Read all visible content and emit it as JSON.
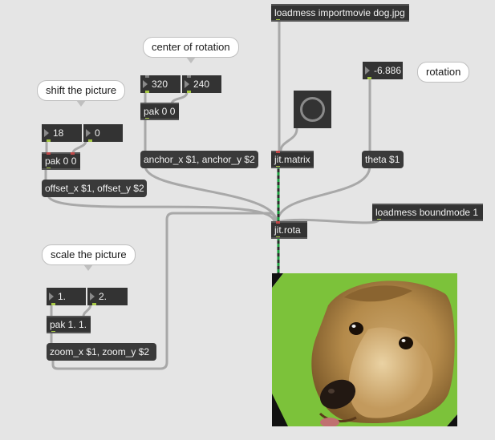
{
  "objects": {
    "loadmess_movie": "loadmess importmovie dog.jpg",
    "pak_anchor": "pak 0 0",
    "anchor_msg": "anchor_x $1, anchor_y $2",
    "num_320": "320",
    "num_240": "240",
    "num_theta": "-6.886",
    "theta_msg": "theta $1",
    "jit_matrix": "jit.matrix",
    "num_18": "18",
    "num_0": "0",
    "pak_offset": "pak 0 0",
    "offset_msg": "offset_x $1, offset_y $2",
    "jit_rota": "jit.rota",
    "loadmess_bound": "loadmess boundmode 1",
    "num_scale_x": "1.",
    "num_scale_y": "2.",
    "pak_zoom": "pak 1. 1.",
    "zoom_msg": "zoom_x $1, zoom_y $2"
  },
  "comments": {
    "center": "center of rotation",
    "shift": "shift the picture",
    "rotation": "rotation",
    "scale": "scale the picture"
  },
  "colors": {
    "canvas": "#e5e5e5",
    "object": "#333333",
    "cord_gray": "#a8a8a8",
    "cord_matrix": "#1b9e3e",
    "green_screen": "#7cc23a"
  },
  "icons": {
    "toggle": "toggle-circle-icon",
    "number_arrow": "number-triangle-icon"
  }
}
